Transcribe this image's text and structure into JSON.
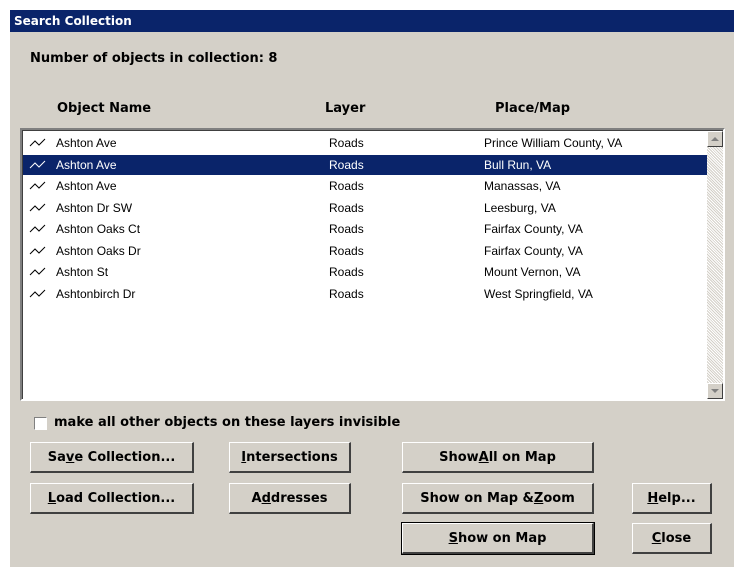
{
  "window": {
    "title": "Search Collection"
  },
  "summary": {
    "count_text": "Number of objects in collection:  8"
  },
  "columns": {
    "name": "Object Name",
    "layer": "Layer",
    "place": "Place/Map"
  },
  "rows": [
    {
      "name": "Ashton Ave",
      "layer": "Roads",
      "place": "Prince William County, VA",
      "icon": "road-line-icon",
      "selected": false
    },
    {
      "name": "Ashton Ave",
      "layer": "Roads",
      "place": "Bull Run, VA",
      "icon": "road-line-icon",
      "selected": true
    },
    {
      "name": "Ashton Ave",
      "layer": "Roads",
      "place": "Manassas, VA",
      "icon": "road-line-icon",
      "selected": false
    },
    {
      "name": "Ashton Dr SW",
      "layer": "Roads",
      "place": "Leesburg, VA",
      "icon": "road-line-icon",
      "selected": false
    },
    {
      "name": "Ashton Oaks Ct",
      "layer": "Roads",
      "place": "Fairfax County, VA",
      "icon": "road-line-icon",
      "selected": false
    },
    {
      "name": "Ashton Oaks Dr",
      "layer": "Roads",
      "place": "Fairfax County, VA",
      "icon": "road-line-icon",
      "selected": false
    },
    {
      "name": "Ashton St",
      "layer": "Roads",
      "place": "Mount Vernon, VA",
      "icon": "road-line-icon",
      "selected": false
    },
    {
      "name": "Ashtonbirch Dr",
      "layer": "Roads",
      "place": "West Springfield, VA",
      "icon": "road-line-icon",
      "selected": false
    }
  ],
  "options": {
    "invisible_label": "make all other objects on these layers invisible",
    "invisible_checked": false
  },
  "buttons": {
    "save": {
      "pre": "Sa",
      "key": "v",
      "post": "e Collection..."
    },
    "load": {
      "pre": "",
      "key": "L",
      "post": "oad Collection..."
    },
    "intersections": {
      "pre": "",
      "key": "I",
      "post": "ntersections"
    },
    "addresses": {
      "pre": "A",
      "key": "d",
      "post": "dresses"
    },
    "show_all": {
      "pre": "Show ",
      "key": "A",
      "post": "ll on Map"
    },
    "show_zoom": {
      "pre": "Show on Map & ",
      "key": "Z",
      "post": "oom"
    },
    "show": {
      "pre": "",
      "key": "S",
      "post": "how on Map"
    },
    "help": {
      "pre": "",
      "key": "H",
      "post": "elp..."
    },
    "close": {
      "pre": "",
      "key": "C",
      "post": "lose"
    }
  },
  "colors": {
    "titlebar": "#0a246a",
    "selection": "#0a246a",
    "face": "#d4d0c8"
  }
}
